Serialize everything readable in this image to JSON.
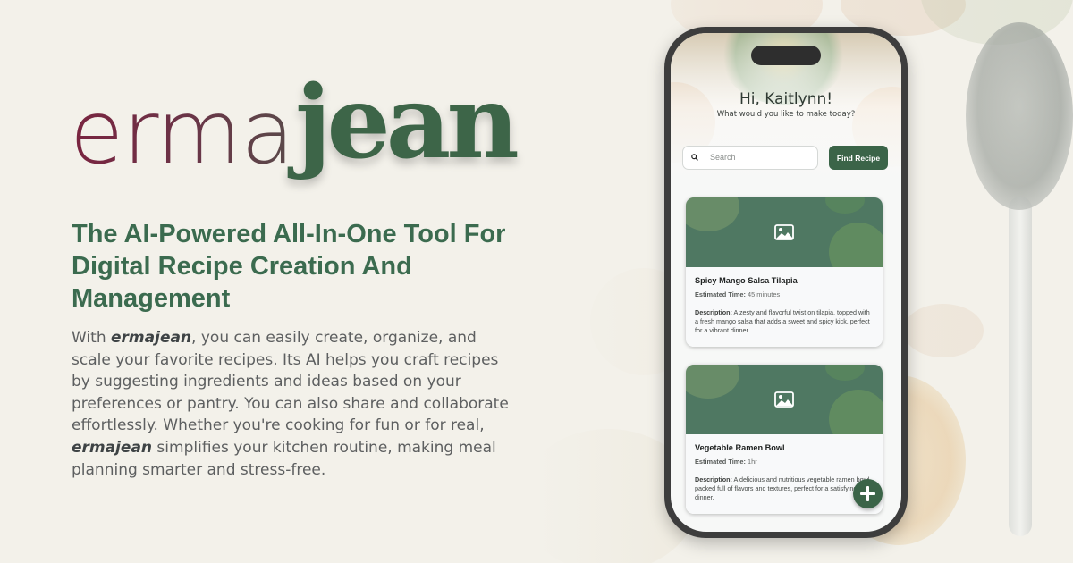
{
  "brand": {
    "part1": "erma",
    "part2": "jean",
    "color1": "#7a2440",
    "color2": "#3d6548"
  },
  "headline": "The AI-Powered All-In-One Tool For Digital Recipe Creation And Management",
  "paragraph": {
    "t1": "With ",
    "b1": "ermajean",
    "t2": ", you can easily create, organize, and scale your favorite recipes. Its AI helps you craft recipes by suggesting ingredients and ideas based on your preferences or pantry. You can also share and collaborate effortlessly. Whether you're cooking for fun or for real, ",
    "b2": "ermajean",
    "t3": " simplifies your kitchen routine, making meal planning smarter and stress-free."
  },
  "app": {
    "greeting": "Hi, Kaitlynn!",
    "subtitle": "What would you like to make today?",
    "search_placeholder": "Search",
    "find_button": "Find Recipe",
    "accent": "#3b6448",
    "recipes": [
      {
        "title": "Spicy Mango Salsa Tilapia",
        "time_label": "Estimated Time:",
        "time": "45 minutes",
        "desc_label": "Description:",
        "desc": "A zesty and flavorful twist on tilapia, topped with a fresh mango salsa that adds a sweet and spicy kick, perfect for a vibrant dinner."
      },
      {
        "title": "Vegetable Ramen Bowl",
        "time_label": "Estimated Time:",
        "time": "1hr",
        "desc_label": "Description:",
        "desc": "A delicious and nutritious vegetable ramen bowl packed full of flavors and textures, perfect for a satisfying dinner."
      }
    ],
    "icons": {
      "search": "search-icon",
      "image": "image-placeholder-icon",
      "fab": "plus-icon"
    }
  }
}
